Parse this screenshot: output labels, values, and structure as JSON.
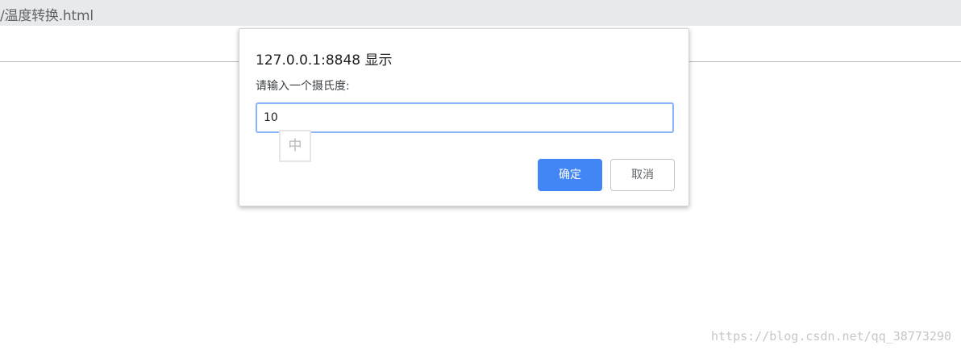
{
  "tab": {
    "title": "/温度转换.html"
  },
  "dialog": {
    "title": "127.0.0.1:8848 显示",
    "message": "请输入一个摄氏度:",
    "input_value": "10",
    "ime_indicator": "中",
    "ok_label": "确定",
    "cancel_label": "取消"
  },
  "watermark": "https://blog.csdn.net/qq_38773290",
  "colors": {
    "tabbar_bg": "#e8e9eb",
    "ok_button": "#4285f4",
    "input_focus_border": "#8ab4f8"
  }
}
